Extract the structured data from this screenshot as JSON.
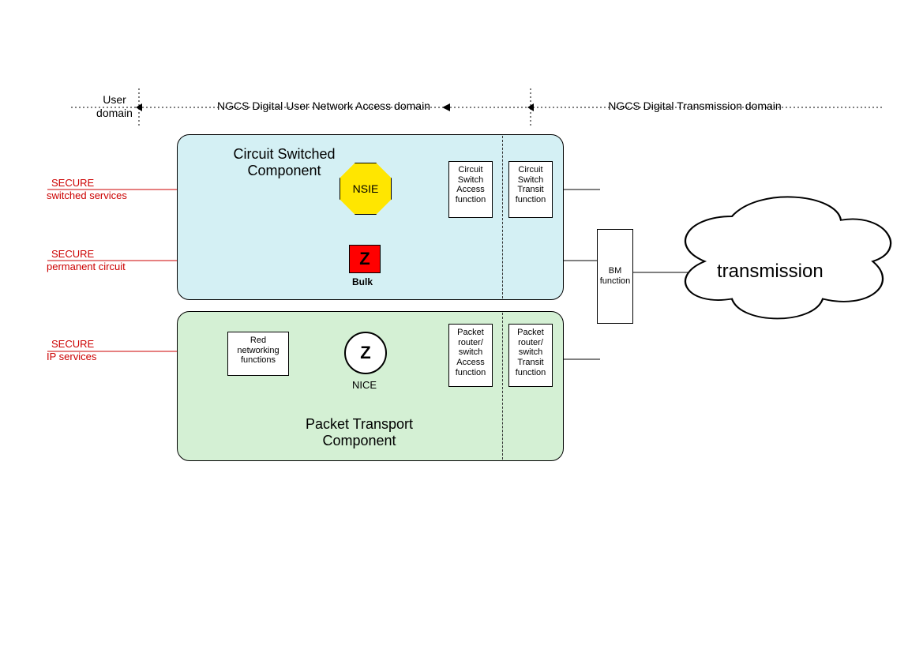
{
  "domains": {
    "user": "User\ndomain",
    "access": "NGCS Digital User  Network Access domain",
    "transmission": "NGCS Digital Transmission domain"
  },
  "services": {
    "switched": {
      "line1": "SECURE",
      "line2": "switched services"
    },
    "permanent": {
      "line1": "SECURE",
      "line2": "permanent circuit"
    },
    "ip": {
      "line1": "SECURE",
      "line2": "IP services"
    }
  },
  "csc": {
    "title1": "Circuit Switched",
    "title2": "Component",
    "nsie": "NSIE",
    "bulk_z": "Z",
    "bulk_label": "Bulk",
    "access_box": "Circuit Switch Access function",
    "transit_box": "Circuit Switch Transit function"
  },
  "ptc": {
    "title1": "Packet Transport",
    "title2": "Component",
    "red_net": "Red networking functions",
    "z": "Z",
    "nice_label": "NICE",
    "access_box": "Packet router/ switch Access function",
    "transit_box": "Packet router/ switch Transit function"
  },
  "bm": "BM function",
  "cloud": "transmission"
}
